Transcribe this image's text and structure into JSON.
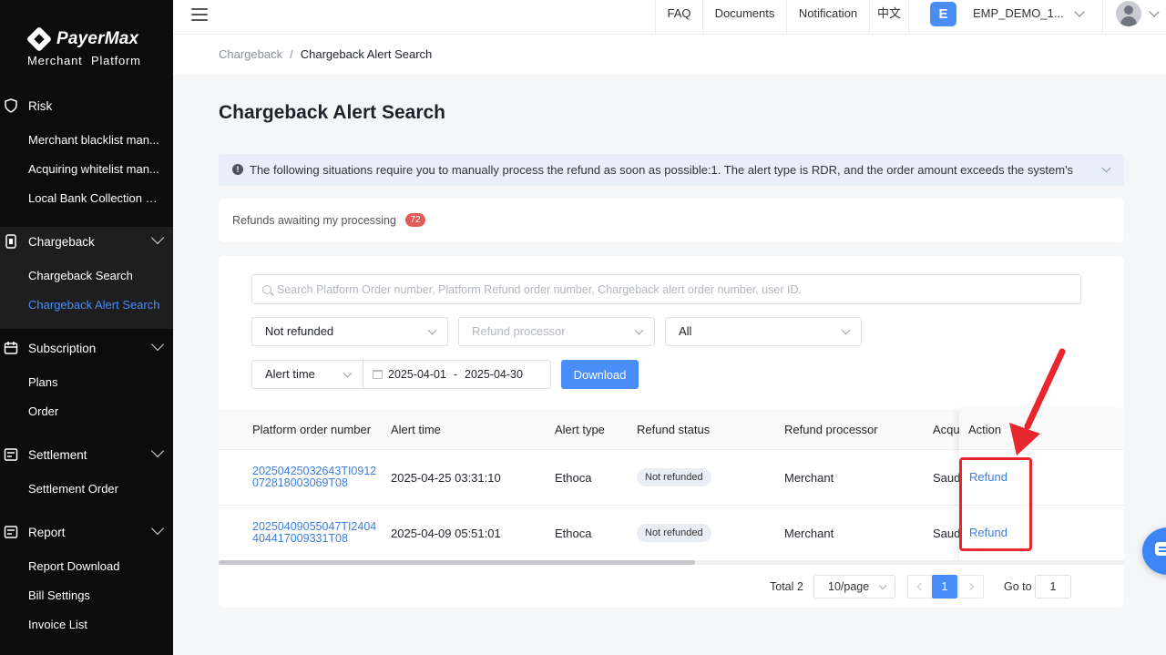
{
  "brand": {
    "name": "PayerMax",
    "subtitle": "Merchant  Platform"
  },
  "sidebar": {
    "risk": {
      "label": "Risk",
      "items": [
        "Merchant blacklist man...",
        "Acquiring whitelist man...",
        "Local Bank Collection List"
      ]
    },
    "chargeback": {
      "label": "Chargeback",
      "items": [
        "Chargeback Search",
        "Chargeback Alert Search"
      ],
      "active": "Chargeback Alert Search"
    },
    "subscription": {
      "label": "Subscription",
      "items": [
        "Plans",
        "Order"
      ]
    },
    "settlement": {
      "label": "Settlement",
      "items": [
        "Settlement Order"
      ]
    },
    "report": {
      "label": "Report",
      "items": [
        "Report Download",
        "Bill Settings",
        "Invoice List"
      ]
    }
  },
  "header": {
    "faq": "FAQ",
    "documents": "Documents",
    "notification": "Notification",
    "language": "中文",
    "account_initial": "E",
    "account_name": "EMP_DEMO_1..."
  },
  "breadcrumb": {
    "parent": "Chargeback",
    "separator": "/",
    "current": "Chargeback Alert Search"
  },
  "page_title": "Chargeback Alert Search",
  "notice": "The following situations require you to manually process the refund as soon as possible:1. The alert type is RDR, and the order amount exceeds the system's",
  "awaiting": {
    "label": "Refunds awaiting my processing",
    "count": "72"
  },
  "filters": {
    "search_placeholder": "Search Platform Order number, Platform Refund order number, Chargeback alert order number, user ID.",
    "refund_status": "Not refunded",
    "refund_processor_placeholder": "Refund processor",
    "alert_type": "All",
    "time_type": "Alert time",
    "date_from": "2025-04-01",
    "date_sep": "-",
    "date_to": "2025-04-30",
    "download_label": "Download"
  },
  "table": {
    "columns": {
      "order": "Platform order number",
      "alert_time": "Alert time",
      "alert_type": "Alert type",
      "refund_status": "Refund status",
      "processor": "Refund processor",
      "acquirer": "Acqui",
      "action": "Action"
    },
    "rows": [
      {
        "order": "20250425032643TI0912072818003069T08",
        "alert_time": "2025-04-25 03:31:10",
        "alert_type": "Ethoca",
        "refund_status": "Not refunded",
        "processor": "Merchant",
        "acquirer": "Saud",
        "action": "Refund"
      },
      {
        "order": "20250409055047TI2404404417009331T08",
        "alert_time": "2025-04-09 05:51:01",
        "alert_type": "Ethoca",
        "refund_status": "Not refunded",
        "processor": "Merchant",
        "acquirer": "Saud",
        "action": "Refund"
      }
    ]
  },
  "pagination": {
    "total": "Total 2",
    "page_size": "10/page",
    "current_page": "1",
    "goto_label": "Go to",
    "goto_value": "1"
  },
  "colors": {
    "accent": "#4a8df8",
    "annotation": "#e8262d",
    "sidebar_bg": "#0c0c0c"
  },
  "icons": [
    "menu-icon",
    "search-icon",
    "calendar-icon",
    "info-icon",
    "chat-icon",
    "avatar-icon"
  ]
}
